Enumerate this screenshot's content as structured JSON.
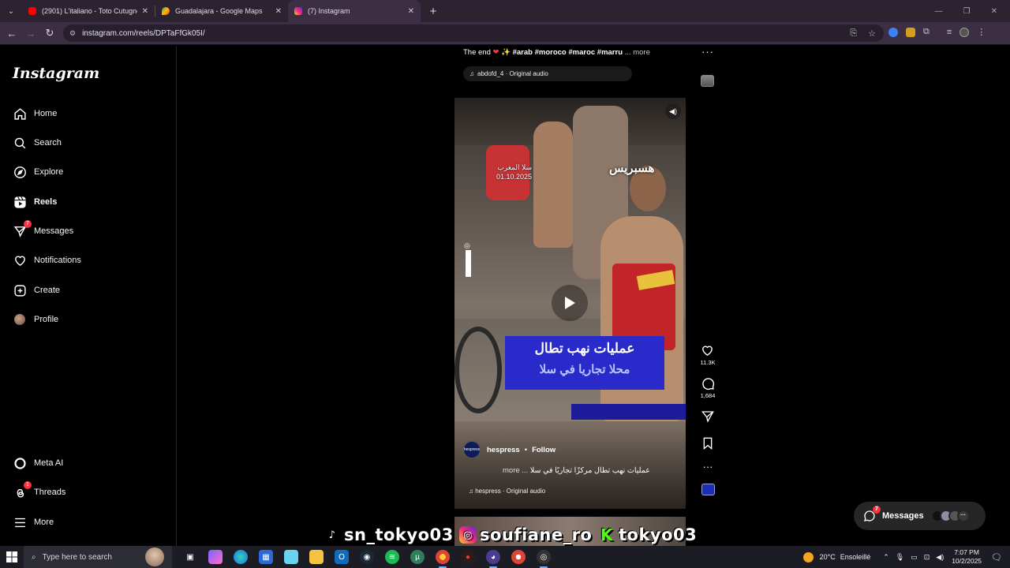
{
  "browser": {
    "tabs": [
      {
        "title": "(2901) L'italiano - Toto Cutugno",
        "favicon_color": "#ff0000",
        "active": false
      },
      {
        "title": "Guadalajara - Google Maps",
        "favicon_color": "#34a853",
        "active": false
      },
      {
        "title": "(7) Instagram",
        "favicon_color": "#e1306c",
        "active": true
      }
    ],
    "url": "instagram.com/reels/DPTaFfGk05I/"
  },
  "sidebar": {
    "logo": "Instagram",
    "items": [
      {
        "label": "Home",
        "icon": "home-icon"
      },
      {
        "label": "Search",
        "icon": "search-icon"
      },
      {
        "label": "Explore",
        "icon": "compass-icon"
      },
      {
        "label": "Reels",
        "icon": "reels-icon"
      },
      {
        "label": "Messages",
        "icon": "messenger-icon",
        "badge": "7"
      },
      {
        "label": "Notifications",
        "icon": "heart-icon"
      },
      {
        "label": "Create",
        "icon": "plus-square-icon"
      },
      {
        "label": "Profile",
        "icon": "avatar"
      }
    ],
    "bottom_items": [
      {
        "label": "Meta AI",
        "icon": "meta-ai-icon"
      },
      {
        "label": "Threads",
        "icon": "threads-icon",
        "badge": "1"
      },
      {
        "label": "More",
        "icon": "menu-icon"
      }
    ]
  },
  "previous_reel": {
    "caption_text": "The end",
    "caption_tags": "#arab #moroco #maroc #marru",
    "more": "... more",
    "audio": "abdofd_4 · Original audio"
  },
  "reel": {
    "video_text": {
      "location": "سلا المغرب",
      "date": "01.10.2025",
      "channel_logo": "هسبريس",
      "banner_line1": "عمليات نهب تطال",
      "banner_line2": "محلا تجاريا في سلا"
    },
    "author": "hespress",
    "follow": "Follow",
    "separator": "•",
    "caption": "عمليات نهب تطال مركزًا تجاريًا في سلا",
    "caption_more": "more ...",
    "audio": "hespress · Original audio",
    "likes": "11.3K",
    "comments": "1,684"
  },
  "watermarks": [
    {
      "text": "sn_tokyo03",
      "icon": "tiktok-icon"
    },
    {
      "text": "soufiane_ro",
      "icon": "instagram-icon"
    },
    {
      "text": "tokyo03",
      "icon": "kick-icon"
    }
  ],
  "messages_pill": {
    "label": "Messages",
    "badge": "7"
  },
  "taskbar": {
    "search_placeholder": "Type here to search",
    "weather": "20°C",
    "weather_desc": "Ensoleillé",
    "time": "7:07 PM",
    "date": "10/2/2025"
  }
}
